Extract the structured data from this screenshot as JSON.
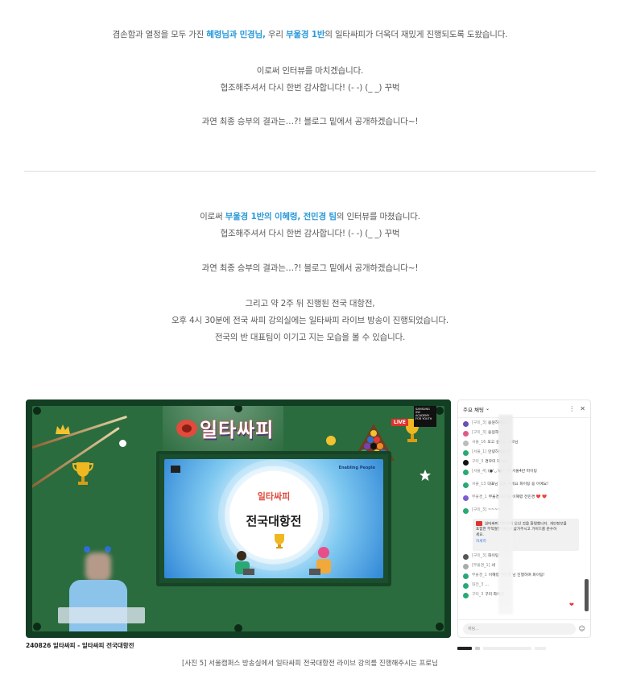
{
  "article": {
    "p1": {
      "pre": "겸손함과 열정을 모두 가진 ",
      "h1": "혜령님과 민경님,",
      "mid": " 우리 ",
      "h2": "부울경 1반",
      "post": "의 일타싸피가 더욱더 재밌게 진행되도록 도왔습니다."
    },
    "p2": {
      "line1": "이로써 인터뷰를 마치겠습니다.",
      "line2": "협조해주셔서 다시 한번 감사합니다! (- -) (_ _) 꾸벅"
    },
    "p3": "과연 최종 승부의 결과는…?! 블로그 밑에서 공개하겠습니다~!",
    "p4": {
      "pre": "이로써 ",
      "h1": "부울경 1반의 이혜령, 전민경 팀",
      "post": "의 인터뷰를 마쳤습니다.",
      "line2": "협조해주셔서 다시 한번 감사합니다! (- -) (_ _) 꾸벅"
    },
    "p5": "과연 최종 승부의 결과는…?! 블로그 밑에서 공개하겠습니다~!",
    "p6": {
      "line1": "그리고 약 2주 뒤 진행된 전국 대항전,",
      "line2": "오후 4시 30분에 전국 싸피 강의실에는 일타싸피 라이브 방송이 진행되었습니다.",
      "line3": "전국의 반 대표팀이 이기고 지는 모습을 볼 수 있습니다."
    }
  },
  "screenshot": {
    "logo_text": "일타싸피",
    "board_logo_text": "일타싸피",
    "board_title": "전국대항전",
    "enabling_text": "Enabling People",
    "live_badge": "LIVE",
    "corner_logo_text": "SAMSUNG SW ACADEMY FOR YOUTH",
    "label": "240826 일타싸피 - 일타싸피 전국대항전"
  },
  "chat": {
    "header": "주요 채팅",
    "dropdown_icon": "chevron-down-icon",
    "more_icon": "more-vert-icon",
    "close_icon": "close-icon",
    "messages": [
      {
        "name": "[구미_3]",
        "text": "응원하세요!",
        "color": "#6a4fb3"
      },
      {
        "name": "[구미_3]",
        "text": "응원해~~",
        "color": "#e0598a"
      },
      {
        "name": "서울_16",
        "text": "오고 싶어요 프로님",
        "color": "#bbbbbb"
      },
      {
        "name": "[서울_1]",
        "text": "안녕하세요~!",
        "color": "#2aa876"
      },
      {
        "name": "구미_3",
        "text": "경우미 화이팅",
        "color": "#111111"
      },
      {
        "name": "[서울_4]",
        "text": "(●'◡'●) ~!! 서울4반 파이팅",
        "color": "#2aa876"
      },
      {
        "name": "서울_13",
        "text": "대표님 힘을 주세요 화이팅 응 이예요!",
        "color": "#2aa876"
      },
      {
        "name": "부울경_1",
        "text": "부울경 화이팅 이혜령 전민경 ❤️ ❤️",
        "color": "#7b5fd0"
      },
      {
        "name": "[구미_3]",
        "text": "~~~~",
        "color": "#2aa876"
      }
    ],
    "pinned": {
      "line1": "일타싸피 채팅창에 오신 것을 환영합니다. 개인정보를",
      "line2": "포함한 부적절한 채팅은 삼가주시고 가이드를 준수하",
      "line3": "세요.",
      "more": "자세히"
    },
    "messages2": [
      {
        "name": "[구미_3]",
        "text": "화이팅",
        "color": "#555555"
      },
      {
        "name": "[부울경_1]",
        "text": "네",
        "color": "#aaaaaa"
      },
      {
        "name": "부울경_1",
        "text": "이혜령 전민경 님 진행하며 화이팅!",
        "color": "#2aa876"
      },
      {
        "name": "대전_3",
        "text": "...",
        "color": "#2aa876"
      },
      {
        "name": "구미_3",
        "text": "구미 화이팅",
        "color": "#2aa876"
      }
    ],
    "input_placeholder": "채팅...",
    "emoji_icon": "smile-icon"
  },
  "photo_caption": "[사진 5] 서울캠퍼스 방송실에서 일타싸피 전국대항전 라이브 강의를 진행해주시는 프로님",
  "colors": {
    "highlight": "#2c9ad9",
    "felt": "#2b6c3e",
    "rail": "#123e23",
    "live": "#e0332f"
  }
}
